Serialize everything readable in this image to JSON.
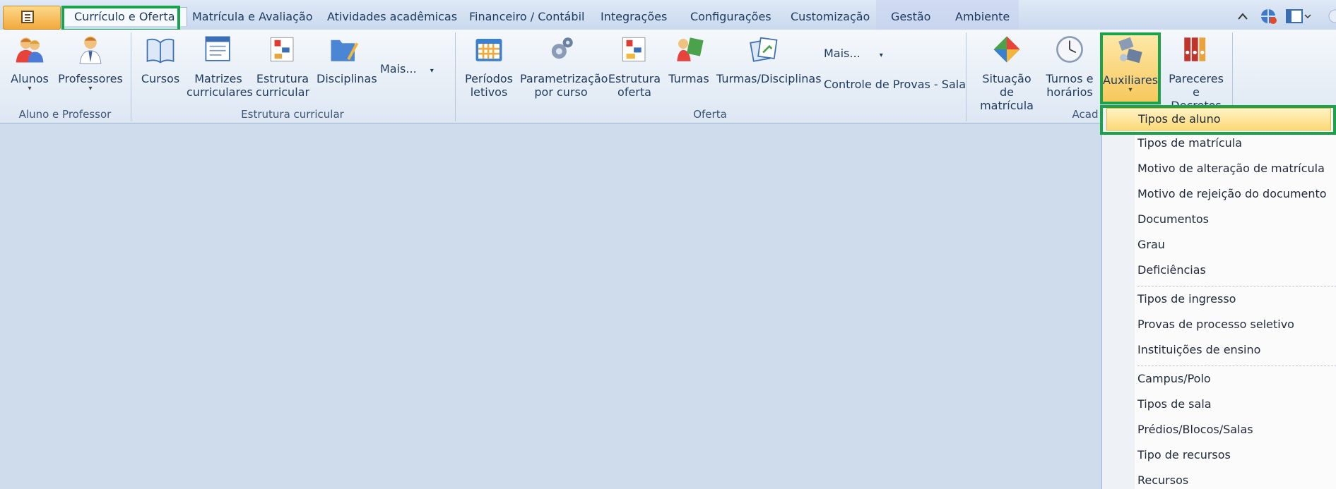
{
  "tabs": [
    "Currículo e Oferta",
    "Matrícula e Avaliação",
    "Atividades acadêmicas",
    "Financeiro / Contábil",
    "Integrações",
    "Configurações",
    "Customização",
    "Gestão",
    "Ambiente"
  ],
  "groups": {
    "aluno_professor": {
      "label": "Aluno e Professor",
      "buttons": [
        "Alunos",
        "Professores"
      ]
    },
    "estrutura": {
      "label": "Estrutura curricular",
      "buttons": [
        "Cursos",
        "Matrizes curriculares",
        "Estrutura curricular",
        "Disciplinas"
      ],
      "more": "Mais..."
    },
    "oferta": {
      "label": "Oferta",
      "buttons": [
        "Períodos letivos",
        "Parametrização por curso",
        "Estrutura oferta",
        "Turmas",
        "Turmas/Disciplinas"
      ],
      "more": "Mais...",
      "extra": "Controle de Provas - Sala"
    },
    "acad": {
      "label": "Acad",
      "buttons": [
        "Situação de matrícula",
        "Turnos e horários",
        "Auxiliares",
        "Pareceres e Decretos"
      ]
    }
  },
  "menu": {
    "items": [
      "Tipos de aluno",
      "Tipos de matrícula",
      "Motivo de alteração de matrícula",
      "Motivo de rejeição do documento",
      "Documentos",
      "Grau",
      "Deficiências",
      "Tipos de ingresso",
      "Provas de processo seletivo",
      "Instituições de ensino",
      "Campus/Polo",
      "Tipos de sala",
      "Prédios/Blocos/Salas",
      "Tipo de recursos",
      "Recursos"
    ],
    "selected": "Tipos de aluno"
  },
  "colors": {
    "highlight": "#1aa34a",
    "menu_selected": "#fcd977",
    "ribbon": "#dde7f3"
  }
}
